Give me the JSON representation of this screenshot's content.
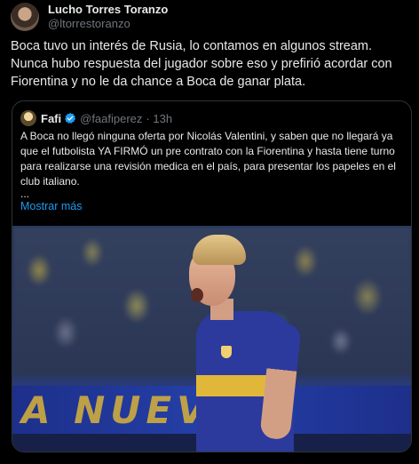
{
  "tweet": {
    "author": {
      "display_name": "Lucho Torres Toranzo",
      "handle": "@ltorrestoranzo"
    },
    "text": "Boca tuvo un interés de Rusia, lo contamos en algunos stream. Nunca hubo respuesta del jugador sobre eso y prefirió acordar con Fiorentina y no le da chance a Boca de ganar plata."
  },
  "quote": {
    "author": {
      "display_name": "Fafi",
      "handle": "@faafiperez",
      "time": "· 13h",
      "verified_icon": "verified-badge-icon"
    },
    "text": "A Boca no llegó ninguna oferta por Nicolás Valentini, y saben que no llegará ya que el futbolista YA FIRMÓ un pre contrato con la Fiorentina y hasta tiene turno para realizarse una revisión medica en el país, para presentar los papeles en el club italiano.",
    "ellipsis": "...",
    "show_more": "Mostrar más",
    "image": {
      "banner_text": "A NUEV"
    }
  },
  "colors": {
    "background": "#000000",
    "text": "#e7e9ea",
    "secondary": "#71767b",
    "link": "#1d9bf0",
    "border": "#2f3336"
  }
}
